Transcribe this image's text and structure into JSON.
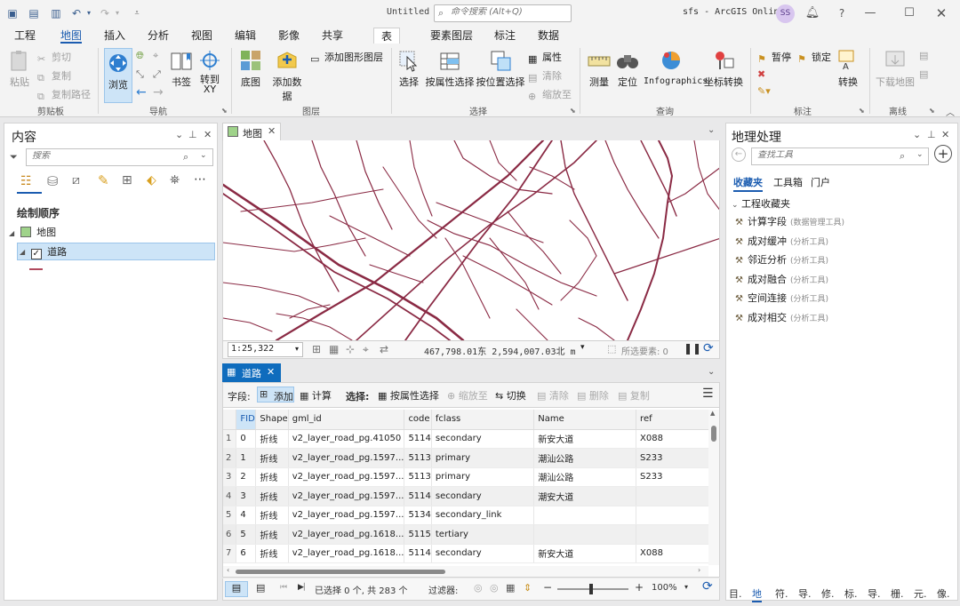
{
  "titlebar": {
    "document_title": "Untitled",
    "command_search_placeholder": "命令搜索 (Alt+Q)",
    "right_title": "sfs - ArcGIS Online",
    "user_initials": "SS"
  },
  "menu": {
    "tabs": [
      "工程",
      "地图",
      "插入",
      "分析",
      "视图",
      "编辑",
      "影像",
      "共享"
    ],
    "active": "地图",
    "context_tabs": [
      "表",
      "要素图层",
      "标注",
      "数据"
    ]
  },
  "ribbon": {
    "clipboard": {
      "paste": "粘贴",
      "cut": "剪切",
      "copy": "复制",
      "copy_path": "复制路径",
      "label": "剪贴板"
    },
    "navigate": {
      "explore": "浏览",
      "bookmarks": "书签",
      "goto": "转到\nXY",
      "label": "导航"
    },
    "layer": {
      "basemap": "底图",
      "add_data": "添加数据",
      "add_graphics": "添加图形图层",
      "label": "图层"
    },
    "selection": {
      "select": "选择",
      "by_attr": "按属性选择",
      "by_loc": "按位置选择",
      "attributes": "属性",
      "clear": "清除",
      "zoom_to": "缩放至",
      "label": "选择"
    },
    "inquiry": {
      "measure": "测量",
      "locate": "定位",
      "infographics": "Infographics",
      "coord": "坐标转换",
      "label": "查询"
    },
    "labeling": {
      "pause": "暂停",
      "lock": "锁定",
      "convert": "转换",
      "label": "标注"
    },
    "offline": {
      "download": "下载地图",
      "label": "离线"
    }
  },
  "contents": {
    "title": "内容",
    "search_placeholder": "搜索",
    "drawing_order": "绘制顺序",
    "map_node": "地图",
    "layer_node": "道路",
    "layer_symbol_color": "#b04a5e"
  },
  "map_view": {
    "tab_label": "地图",
    "scale": "1:25,322",
    "coords": "467,798.01东 2,594,007.03北 m",
    "selected_label": "所选要素: 0",
    "road_color": "#8a2a44"
  },
  "attr_table": {
    "tab_label": "道路",
    "toolbar": {
      "field": "字段:",
      "add": "添加",
      "calculate": "计算",
      "selection": "选择:",
      "by_attr": "按属性选择",
      "zoom_to": "缩放至",
      "switch": "切换",
      "clear": "清除",
      "delete": "删除",
      "copy": "复制"
    },
    "columns": [
      "FID",
      "Shape",
      "gml_id",
      "code",
      "fclass",
      "Name",
      "ref"
    ],
    "rows": [
      [
        "1",
        "0",
        "折线",
        "v2_layer_road_pg.41050",
        "5114",
        "secondary",
        "新安大道",
        "X088"
      ],
      [
        "2",
        "1",
        "折线",
        "v2_layer_road_pg.1597...",
        "5113",
        "primary",
        "潮汕公路",
        "S233"
      ],
      [
        "3",
        "2",
        "折线",
        "v2_layer_road_pg.1597...",
        "5113",
        "primary",
        "潮汕公路",
        "S233"
      ],
      [
        "4",
        "3",
        "折线",
        "v2_layer_road_pg.1597...",
        "5114",
        "secondary",
        "潮安大道",
        ""
      ],
      [
        "5",
        "4",
        "折线",
        "v2_layer_road_pg.1597...",
        "5134",
        "secondary_link",
        "",
        ""
      ],
      [
        "6",
        "5",
        "折线",
        "v2_layer_road_pg.1618...",
        "5115",
        "tertiary",
        "",
        ""
      ],
      [
        "7",
        "6",
        "折线",
        "v2_layer_road_pg.1618...",
        "5114",
        "secondary",
        "新安大道",
        "X088"
      ]
    ],
    "status": "已选择 0 个, 共 283 个",
    "filter": "过滤器:",
    "zoom": "100%"
  },
  "geoprocessing": {
    "title": "地理处理",
    "search_placeholder": "查找工具",
    "tabs": [
      "收藏夹",
      "工具箱",
      "门户"
    ],
    "group": "工程收藏夹",
    "items": [
      {
        "name": "计算字段",
        "toolbox": "(数据管理工具)"
      },
      {
        "name": "成对缓冲",
        "toolbox": "(分析工具)"
      },
      {
        "name": "邻近分析",
        "toolbox": "(分析工具)"
      },
      {
        "name": "成对融合",
        "toolbox": "(分析工具)"
      },
      {
        "name": "空间连接",
        "toolbox": "(分析工具)"
      },
      {
        "name": "成对相交",
        "toolbox": "(分析工具)"
      }
    ],
    "bottom_tabs": [
      "目.",
      "地",
      "符.",
      "导.",
      "修.",
      "标.",
      "导.",
      "栅.",
      "元.",
      "像."
    ]
  },
  "colors": {
    "accent": "#1b5cb0",
    "tab_blue": "#0f6cbd"
  }
}
